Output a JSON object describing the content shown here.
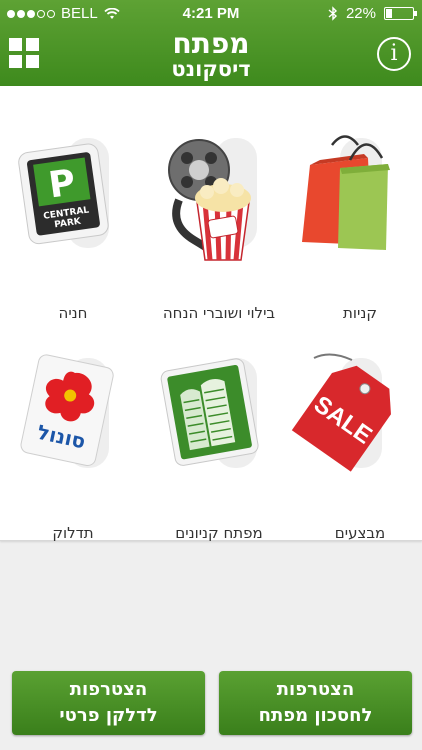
{
  "status_bar": {
    "carrier": "BELL",
    "time": "4:21 PM",
    "battery_percent": "22%",
    "battery_level": 0.22,
    "signal_bars_filled": 3,
    "signal_bars_total": 5
  },
  "header": {
    "logo_line1": "מפתח",
    "logo_line2": "דיסקונט",
    "info_label": "i",
    "background_color": "#4c9428"
  },
  "tiles": [
    {
      "id": "shopping",
      "label": "קניות",
      "icon": "shopping-bags-icon"
    },
    {
      "id": "leisure",
      "label": "בילוי ושוברי הנחה",
      "icon": "popcorn-film-icon"
    },
    {
      "id": "parking",
      "label": "חניה",
      "icon": "central-park-parking-icon",
      "sign_letter": "P",
      "sign_text_1": "CENTRAL",
      "sign_text_2": "PARK"
    },
    {
      "id": "sales",
      "label": "מבצעים",
      "icon": "sale-tag-icon",
      "tag_text": "SALE"
    },
    {
      "id": "malls",
      "label": "מפתח קניונים",
      "icon": "mall-building-icon"
    },
    {
      "id": "fuel",
      "label": "תדלוק",
      "icon": "sonol-fuel-icon",
      "brand_text": "סונול"
    }
  ],
  "buttons": {
    "join_key_line1": "הצטרפות",
    "join_key_line2": "לחסכון מפתח",
    "join_fuel_line1": "הצטרפות",
    "join_fuel_line2": "לדלקן פרטי"
  }
}
